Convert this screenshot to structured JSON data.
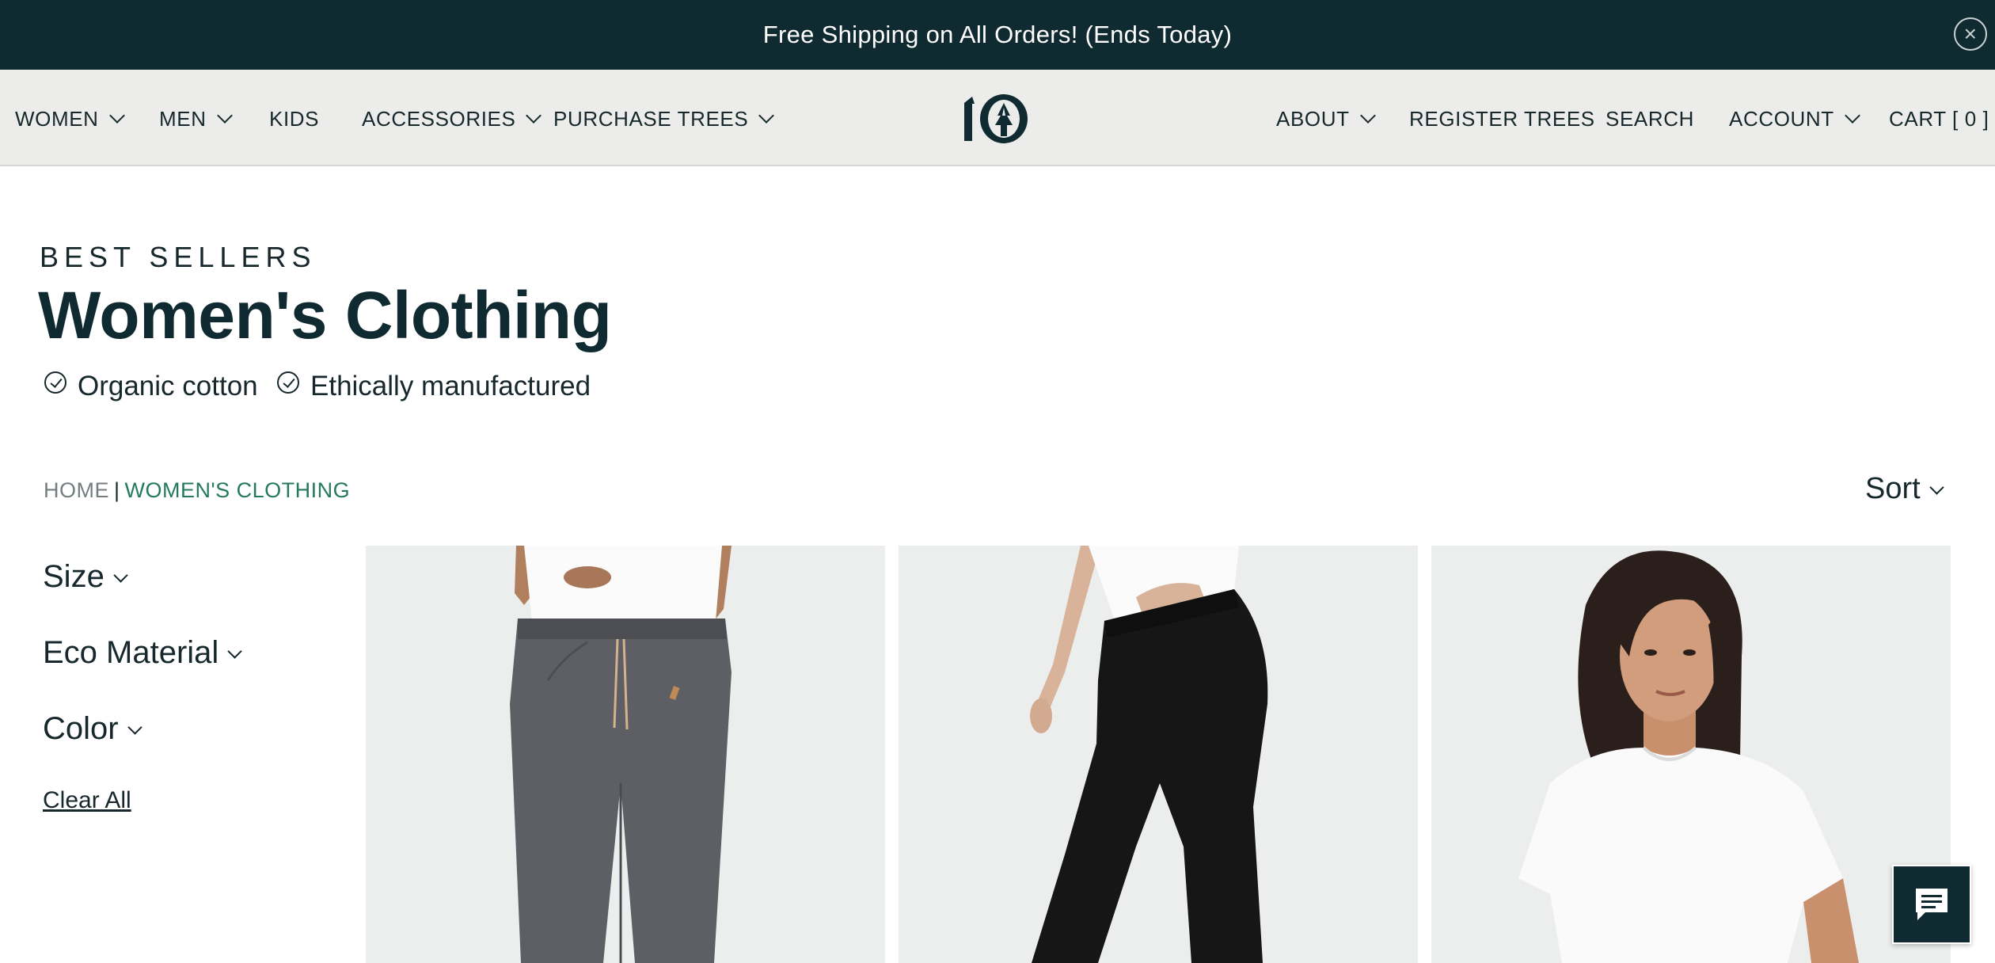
{
  "promo": {
    "text": "Free Shipping on All Orders! (Ends Today)",
    "close_icon": "close-circle-icon"
  },
  "nav": {
    "left": [
      {
        "label": "WOMEN",
        "dropdown": true
      },
      {
        "label": "MEN",
        "dropdown": true
      },
      {
        "label": "KIDS",
        "dropdown": false
      },
      {
        "label": "ACCESSORIES",
        "dropdown": true
      },
      {
        "label": "PURCHASE TREES",
        "dropdown": true
      }
    ],
    "logo": "10",
    "right": [
      {
        "label": "ABOUT",
        "dropdown": true
      },
      {
        "label": "REGISTER TREES",
        "dropdown": false
      },
      {
        "label": "SEARCH",
        "dropdown": false
      },
      {
        "label": "ACCOUNT",
        "dropdown": true
      },
      {
        "label": "CART [ 0 ]",
        "dropdown": false
      }
    ]
  },
  "header": {
    "eyebrow": "BEST SELLERS",
    "title": "Women's Clothing",
    "features": [
      "Organic cotton",
      "Ethically manufactured"
    ]
  },
  "breadcrumb": {
    "home": "HOME",
    "separator": "|",
    "current": "WOMEN'S CLOTHING"
  },
  "sort": {
    "label": "Sort"
  },
  "filters": {
    "items": [
      "Size",
      "Eco Material",
      "Color"
    ],
    "clear_all": "Clear All"
  },
  "products": [
    {
      "image": "heather-grey-joggers"
    },
    {
      "image": "black-leggings"
    },
    {
      "image": "white-t-shirt"
    }
  ],
  "colors": {
    "dark": "#0f2a30",
    "accent_green": "#247a5a",
    "nav_bg": "#ecedea",
    "image_bg": "#eceeed"
  },
  "chat": {
    "icon": "chat-icon"
  }
}
